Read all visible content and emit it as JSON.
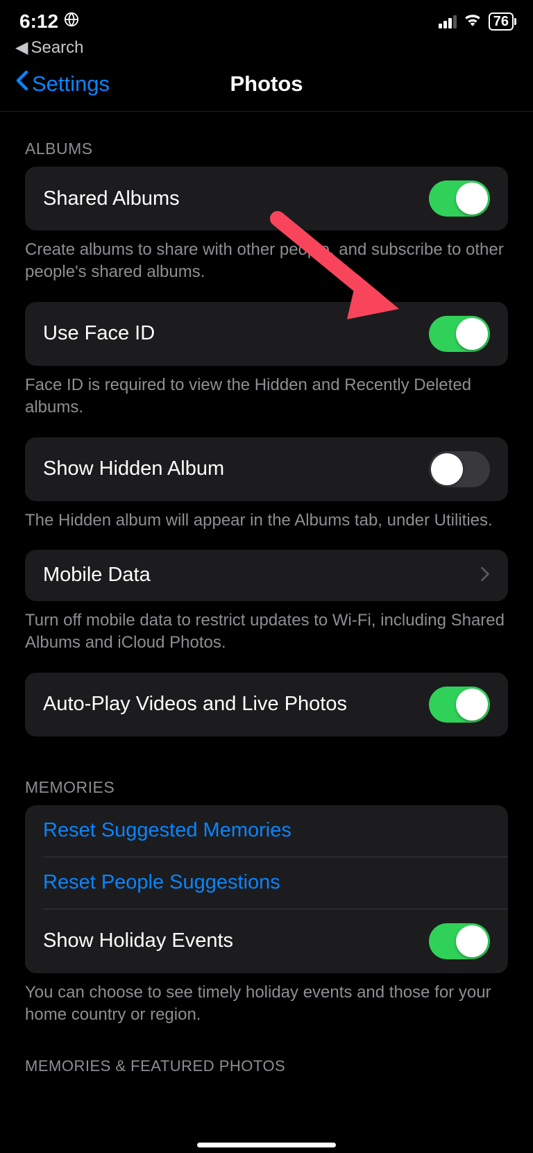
{
  "status": {
    "time": "6:12",
    "battery": "76"
  },
  "breadcrumb": "Search",
  "nav": {
    "back": "Settings",
    "title": "Photos"
  },
  "sections": {
    "albums": {
      "header": "ALBUMS",
      "shared": {
        "label": "Shared Albums",
        "footer": "Create albums to share with other people, and subscribe to other people's shared albums."
      },
      "faceid": {
        "label": "Use Face ID",
        "footer": "Face ID is required to view the Hidden and Recently Deleted albums."
      },
      "hidden": {
        "label": "Show Hidden Album",
        "footer": "The Hidden album will appear in the Albums tab, under Utilities."
      },
      "mobile": {
        "label": "Mobile Data",
        "footer": "Turn off mobile data to restrict updates to Wi-Fi, including Shared Albums and iCloud Photos."
      },
      "autoplay": {
        "label": "Auto-Play Videos and Live Photos"
      }
    },
    "memories": {
      "header": "MEMORIES",
      "reset_mem": "Reset Suggested Memories",
      "reset_people": "Reset People Suggestions",
      "holiday": "Show Holiday Events",
      "footer": "You can choose to see timely holiday events and those for your home country or region."
    },
    "featured": {
      "header": "MEMORIES & FEATURED PHOTOS"
    }
  }
}
